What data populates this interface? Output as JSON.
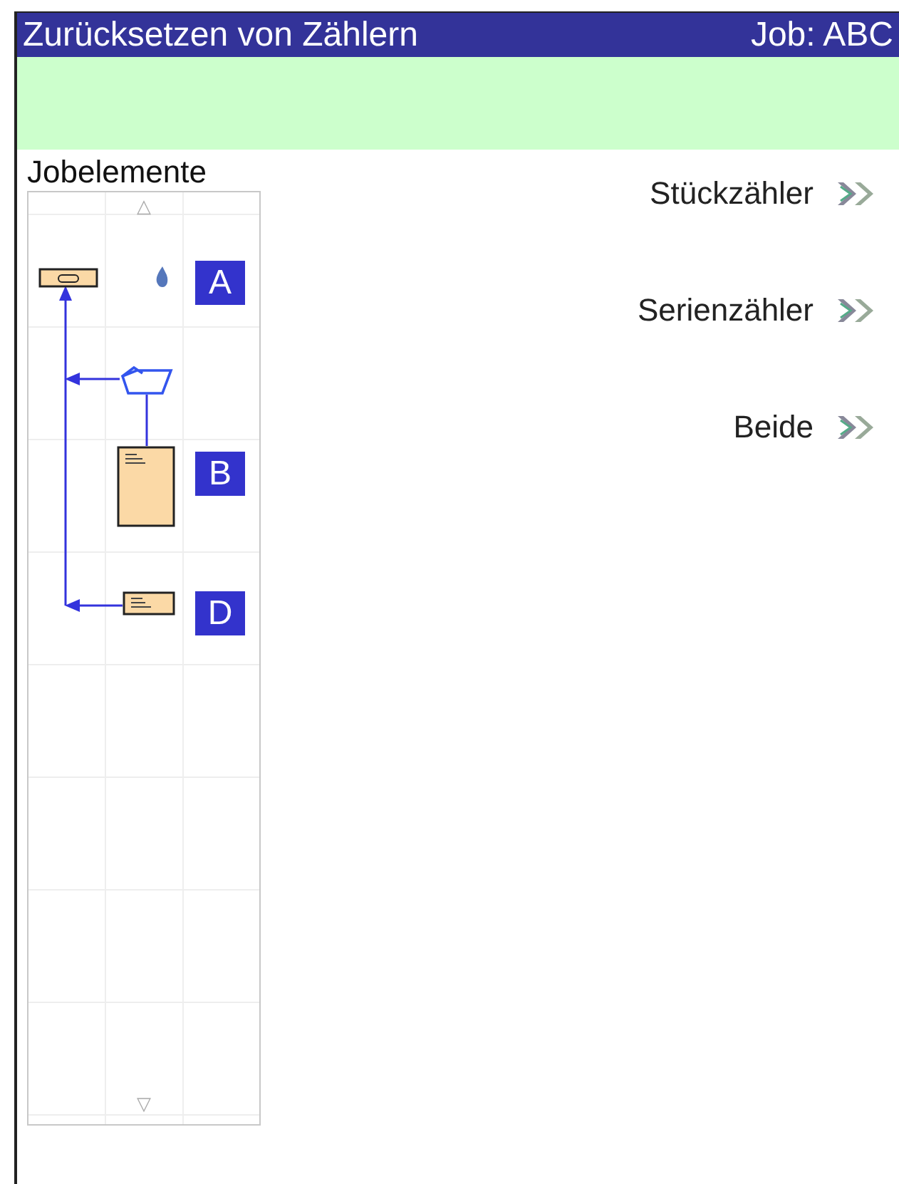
{
  "window": {
    "title": "Zurücksetzen von Zählern",
    "job": "Job: ABC"
  },
  "panel": {
    "label": "Jobelemente",
    "scroll_up": "△",
    "scroll_down": "▽",
    "elements": [
      {
        "kind": "tray",
        "badge": "A"
      },
      {
        "kind": "folder"
      },
      {
        "kind": "sheet",
        "badge": "B"
      },
      {
        "kind": "card",
        "badge": "D"
      }
    ]
  },
  "menu": [
    {
      "label": "Stückzähler"
    },
    {
      "label": "Serienzähler"
    },
    {
      "label": "Beide"
    }
  ]
}
